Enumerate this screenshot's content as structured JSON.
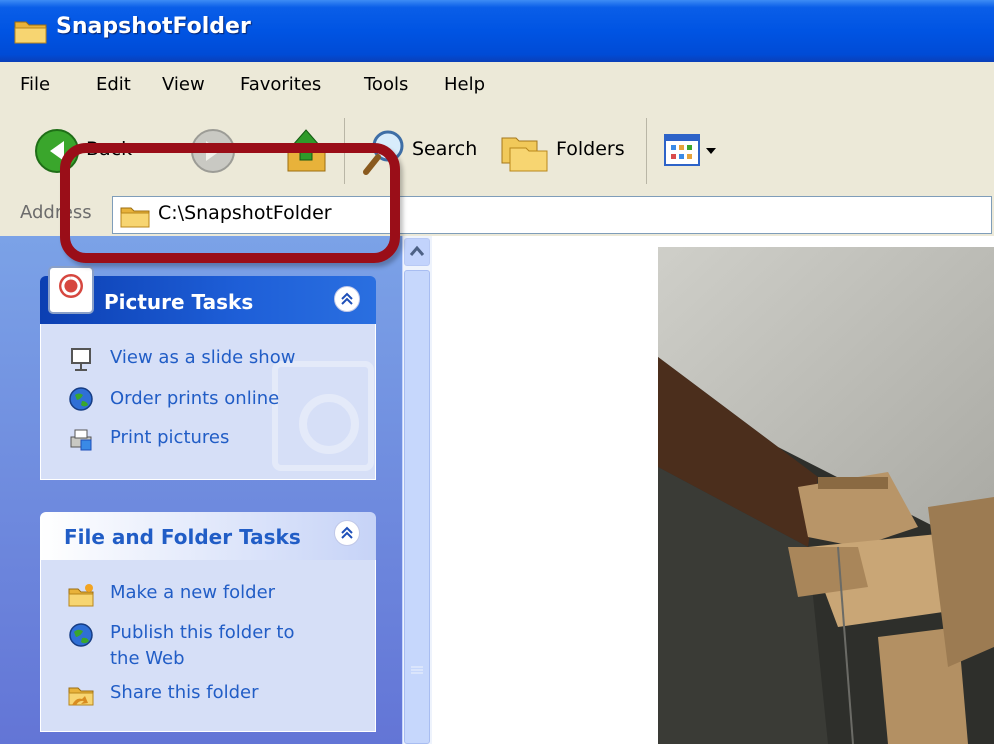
{
  "window": {
    "title": "SnapshotFolder"
  },
  "menu": [
    "File",
    "Edit",
    "View",
    "Favorites",
    "Tools",
    "Help"
  ],
  "toolbar": {
    "back_label": "Back",
    "search_label": "Search",
    "folders_label": "Folders"
  },
  "address": {
    "label": "Address",
    "value": "C:\\SnapshotFolder"
  },
  "picture_tasks": {
    "title": "Picture Tasks",
    "items": [
      "View as a slide show",
      "Order prints online",
      "Print pictures"
    ]
  },
  "file_folder_tasks": {
    "title": "File and Folder Tasks",
    "items": [
      "Make a new folder",
      "Publish this folder to",
      "the Web",
      "Share this folder"
    ]
  },
  "colors": {
    "title_blue": "#0054e3",
    "task_link": "#215dc6",
    "highlight_red": "#9a0e18",
    "chrome": "#ece9d8"
  }
}
